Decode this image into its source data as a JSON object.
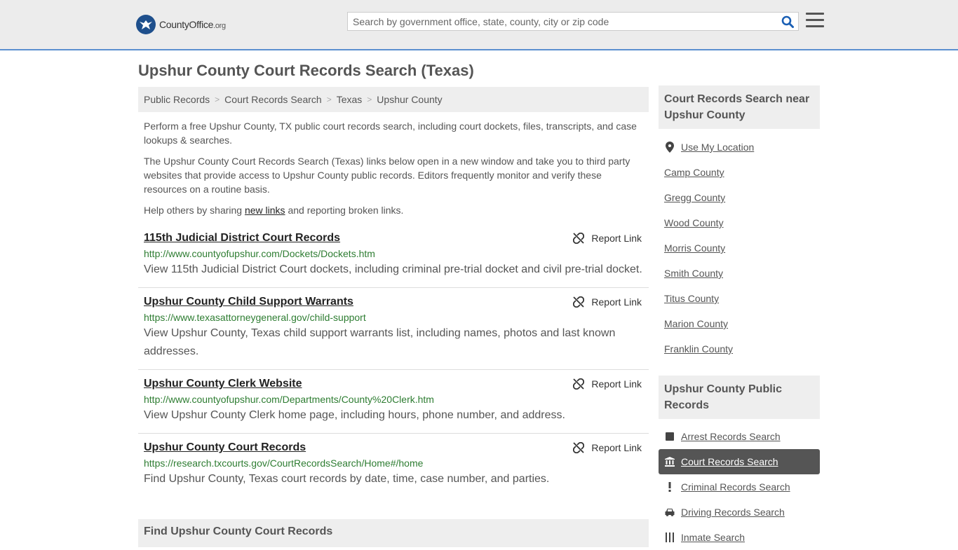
{
  "header": {
    "logo_main": "CountyOffice",
    "logo_suffix": ".org",
    "search_placeholder": "Search by government office, state, county, city or zip code"
  },
  "page": {
    "title": "Upshur County Court Records Search (Texas)"
  },
  "breadcrumb": [
    "Public Records",
    "Court Records Search",
    "Texas",
    "Upshur County"
  ],
  "intro": {
    "p1": "Perform a free Upshur County, TX public court records search, including court dockets, files, transcripts, and case lookups & searches.",
    "p2": "The Upshur County Court Records Search (Texas) links below open in a new window and take you to third party websites that provide access to Upshur County public records. Editors frequently monitor and verify these resources on a routine basis.",
    "p3_before": "Help others by sharing ",
    "p3_link": "new links",
    "p3_after": " and reporting broken links."
  },
  "records": [
    {
      "title": "115th Judicial District Court Records",
      "url": "http://www.countyofupshur.com/Dockets/Dockets.htm",
      "description": "View 115th Judicial District Court dockets, including criminal pre-trial docket and civil pre-trial docket."
    },
    {
      "title": "Upshur County Child Support Warrants",
      "url": "https://www.texasattorneygeneral.gov/child-support",
      "description": "View Upshur County, Texas child support warrants list, including names, photos and last known addresses."
    },
    {
      "title": "Upshur County Clerk Website",
      "url": "http://www.countyofupshur.com/Departments/County%20Clerk.htm",
      "description": "View Upshur County Clerk home page, including hours, phone number, and address."
    },
    {
      "title": "Upshur County Court Records",
      "url": "https://research.txcourts.gov/CourtRecordsSearch/Home#/home",
      "description": "Find Upshur County, Texas court records by date, time, case number, and parties."
    }
  ],
  "report_label": "Report Link",
  "find_heading": "Find Upshur County Court Records",
  "sidebar": {
    "nearby_heading": "Court Records Search near Upshur County",
    "use_location": "Use My Location",
    "nearby": [
      "Camp County",
      "Gregg County",
      "Wood County",
      "Morris County",
      "Smith County",
      "Titus County",
      "Marion County",
      "Franklin County"
    ],
    "public_heading": "Upshur County Public Records",
    "public_items": [
      {
        "label": "Arrest Records Search",
        "icon": "square-icon"
      },
      {
        "label": "Court Records Search",
        "icon": "courthouse-icon",
        "active": true
      },
      {
        "label": "Criminal Records Search",
        "icon": "exclamation-icon"
      },
      {
        "label": "Driving Records Search",
        "icon": "car-icon"
      },
      {
        "label": "Inmate Search",
        "icon": "inmate-icon"
      }
    ]
  },
  "colors": {
    "header_bg": "#ececec",
    "header_border": "#5b8fcf",
    "url_green": "#2e7d32",
    "active_item_bg": "#555555"
  }
}
